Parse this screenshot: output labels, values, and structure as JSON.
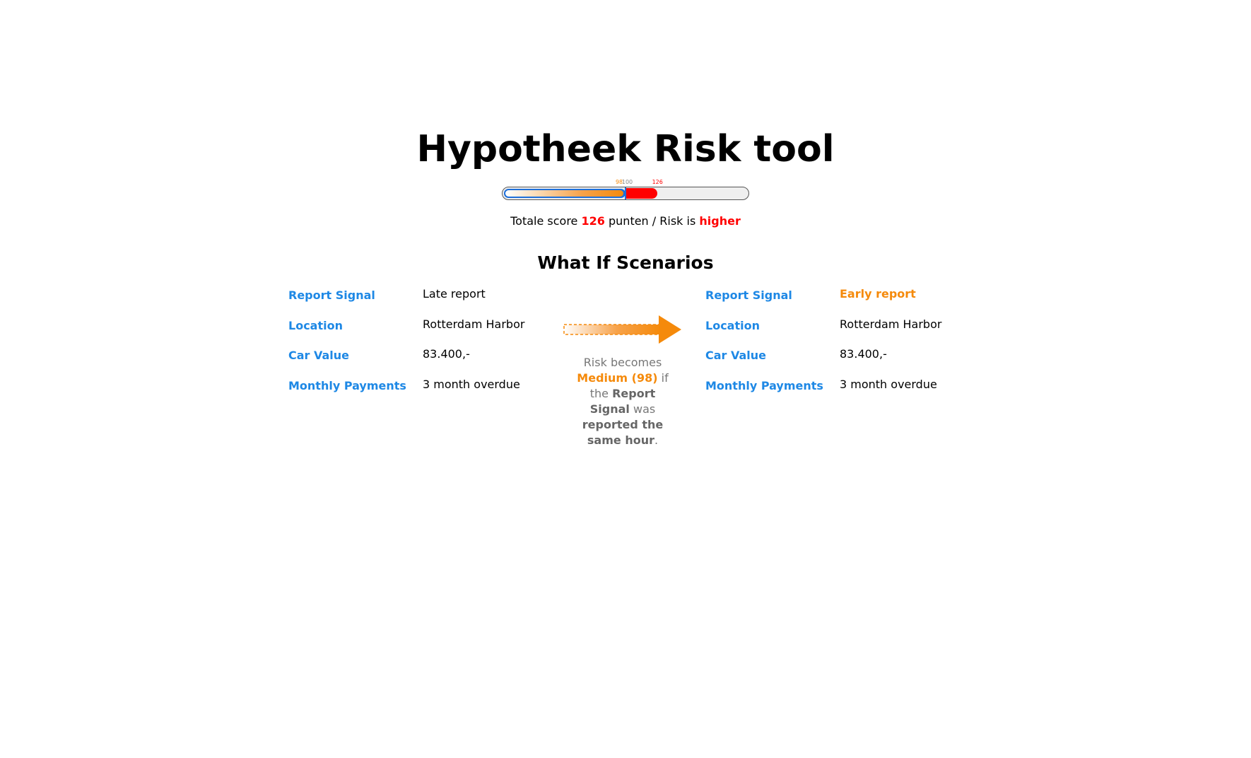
{
  "app": {
    "title": "Hypotheek Risk tool"
  },
  "gauge": {
    "max": 200,
    "threshold": 100,
    "current": 126,
    "alternative": 98,
    "labels": {
      "alternative": "98",
      "threshold": "100",
      "current": "126"
    },
    "colors": {
      "alternative": "#f58a0b",
      "current": "#ff0000",
      "track": "#efefef",
      "base": "#1e6fd9"
    }
  },
  "score": {
    "prefix": "Totale score",
    "value": "126",
    "unit": "punten",
    "separator": "/",
    "risk_prefix": "Risk is",
    "risk_level": "higher"
  },
  "scenarios": {
    "title": "What If Scenarios",
    "current": [
      {
        "label": "Report Signal",
        "value": "Late report"
      },
      {
        "label": "Location",
        "value": "Rotterdam Harbor"
      },
      {
        "label": "Car Value",
        "value": "83.400,-"
      },
      {
        "label": "Monthly Payments",
        "value": "3 month overdue"
      }
    ],
    "whatif": [
      {
        "label": "Report Signal",
        "value": "Early report"
      },
      {
        "label": "Location",
        "value": "Rotterdam Harbor"
      },
      {
        "label": "Car Value",
        "value": "83.400,-"
      },
      {
        "label": "Monthly Payments",
        "value": "3 month overdue"
      }
    ],
    "note": {
      "prefix": "Risk becomes",
      "level": "Medium (98)",
      "mid1": "if the",
      "field": "Report Signal",
      "mid2": "was",
      "condition": "reported the same hour",
      "suffix": "."
    }
  },
  "colors": {
    "label_blue": "#1e88e5",
    "accent_orange": "#f58a0b",
    "risk_red": "#ff0000"
  }
}
